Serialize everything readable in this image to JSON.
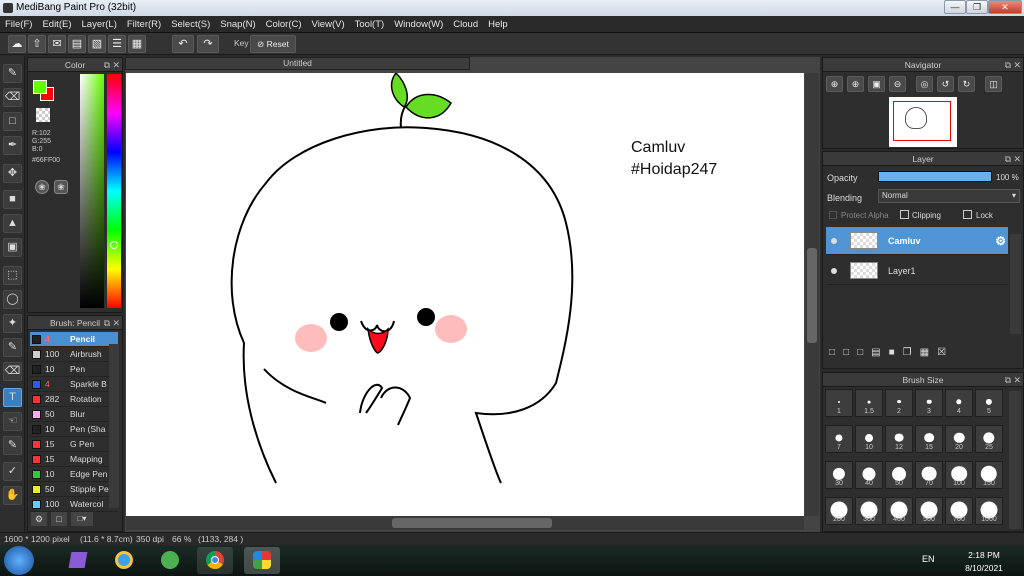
{
  "window": {
    "title": "MediBang Paint Pro (32bit)"
  },
  "menu": [
    "File(F)",
    "Edit(E)",
    "Layer(L)",
    "Filter(R)",
    "Select(S)",
    "Snap(N)",
    "Color(C)",
    "View(V)",
    "Tool(T)",
    "Window(W)",
    "Cloud",
    "Help"
  ],
  "toolbar": {
    "key_label": "Key",
    "reset_label": "Reset"
  },
  "color_panel": {
    "title": "Color",
    "r": "R:102",
    "g": "G:255",
    "b": "B:0",
    "hex": "#66FF00",
    "primary_color": "#66ff00",
    "secondary_color": "#ff0000"
  },
  "brush_panel": {
    "title": "Brush: Pencil",
    "items": [
      {
        "size": "4",
        "name": "Pencil",
        "color": "#222222",
        "selected": true
      },
      {
        "size": "100",
        "name": "Airbrush",
        "color": "#cccccc"
      },
      {
        "size": "10",
        "name": "Pen",
        "color": "#222222"
      },
      {
        "size": "4",
        "name": "Sparkle B",
        "color": "#3355ff"
      },
      {
        "size": "282",
        "name": "Rotation",
        "color": "#ff3333"
      },
      {
        "size": "50",
        "name": "Blur",
        "color": "#ffaaee"
      },
      {
        "size": "10",
        "name": "Pen (Sha",
        "color": "#222222"
      },
      {
        "size": "15",
        "name": "G Pen",
        "color": "#ff3333"
      },
      {
        "size": "15",
        "name": "Mapping",
        "color": "#ff3333"
      },
      {
        "size": "10",
        "name": "Edge Pen",
        "color": "#33cc33"
      },
      {
        "size": "50",
        "name": "Stipple Pe",
        "color": "#eeee22"
      },
      {
        "size": "100",
        "name": "Watercol",
        "color": "#66ccff"
      }
    ]
  },
  "document": {
    "tab_title": "Untitled",
    "text_line1": "Camluv",
    "text_line2": "#Hoidap247"
  },
  "navigator": {
    "title": "Navigator"
  },
  "layer_panel": {
    "title": "Layer",
    "opacity_label": "Opacity",
    "opacity_value": "100 %",
    "opacity_fraction": 1.0,
    "blending_label": "Blending",
    "blending_value": "Normal",
    "protect_alpha": "Protect Alpha",
    "clipping": "Clipping",
    "lock": "Lock",
    "layers": [
      {
        "name": "Camluv",
        "selected": true
      },
      {
        "name": "Layer1",
        "selected": false
      }
    ]
  },
  "brush_size": {
    "title": "Brush Size",
    "sizes": [
      "1",
      "1.5",
      "2",
      "3",
      "4",
      "5",
      "7",
      "10",
      "12",
      "15",
      "20",
      "25",
      "30",
      "40",
      "50",
      "70",
      "100",
      "150",
      "200",
      "300",
      "400",
      "500",
      "700",
      "1000"
    ]
  },
  "status": {
    "dimensions": "1600 * 1200 pixel",
    "physical": "(11.6 * 8.7cm)",
    "dpi": "350 dpi",
    "zoom": "66 %",
    "coords": "(1133, 284 )"
  },
  "taskbar": {
    "lang": "EN",
    "time": "2:18 PM",
    "date": "8/10/2021"
  }
}
